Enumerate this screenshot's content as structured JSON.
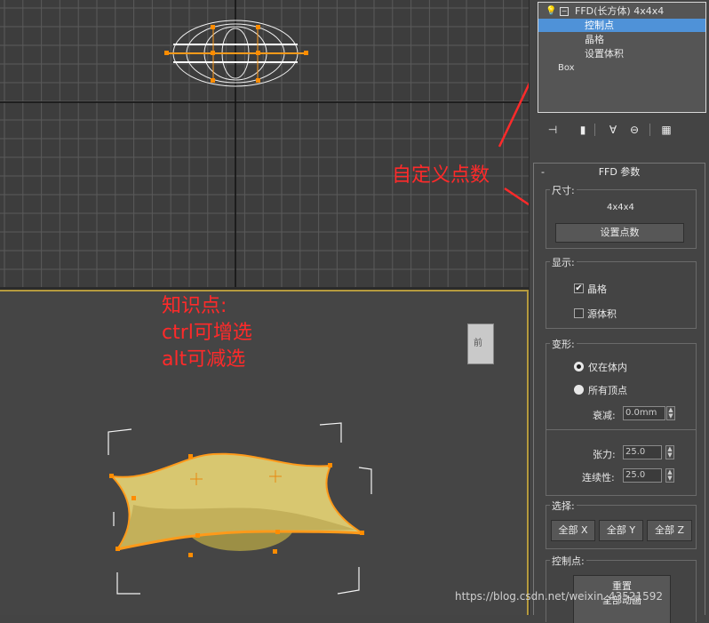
{
  "modifier_stack": {
    "items": [
      {
        "label": "FFD(长方体) 4x4x4",
        "selected": false
      },
      {
        "label": "控制点",
        "selected": true
      },
      {
        "label": "晶格",
        "selected": false
      },
      {
        "label": "设置体积",
        "selected": false
      },
      {
        "label": "Box",
        "selected": false
      }
    ]
  },
  "toolbar": {
    "icons": [
      "pin-stack-icon",
      "show-end-result-icon",
      "make-unique-icon",
      "remove-modifier-icon",
      "configure-sets-icon"
    ]
  },
  "annotations": {
    "custom_points": "自定义点数",
    "knowledge_title": "知识点:",
    "ctrl_tip": "ctrl可增选",
    "alt_tip": "alt可减选"
  },
  "ffd_params": {
    "title": "FFD 参数",
    "collapse": "-",
    "dimensions": {
      "label": "尺寸:",
      "value": "4x4x4",
      "set_points_button": "设置点数"
    },
    "display": {
      "label": "显示:",
      "lattice": {
        "label": "晶格",
        "checked": true
      },
      "source_volume": {
        "label": "源体积",
        "checked": false
      }
    },
    "deform": {
      "label": "变形:",
      "only_in_volume": {
        "label": "仅在体内",
        "selected": true
      },
      "all_vertices": {
        "label": "所有顶点",
        "selected": false
      },
      "falloff": {
        "label": "衰减:",
        "value": "0.0mm"
      },
      "tension": {
        "label": "张力:",
        "value": "25.0"
      },
      "continuity": {
        "label": "连续性:",
        "value": "25.0"
      }
    },
    "selection": {
      "label": "选择:",
      "all_x": "全部 X",
      "all_y": "全部 Y",
      "all_z": "全部 Z"
    },
    "control_points": {
      "label": "控制点:",
      "reset": "重置",
      "animate_all": "全部动画"
    }
  },
  "viewcube": {
    "label": "前"
  },
  "watermark": "https://blog.csdn.net/weixin_43521592",
  "colors": {
    "annotation_red": "#ff2a2a",
    "selection_blue": "#4f92d8",
    "active_viewport_border": "#b59a3e",
    "lattice_orange": "#ff8c00",
    "object_yellow": "#d8c770"
  }
}
